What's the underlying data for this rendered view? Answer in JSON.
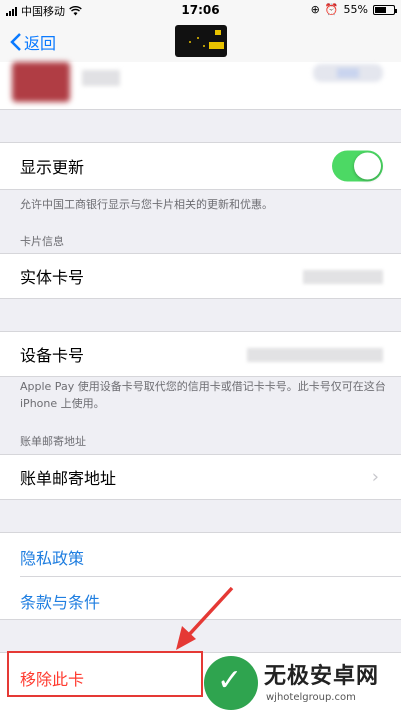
{
  "status_bar": {
    "carrier": "中国移动",
    "time": "17:06",
    "battery": "55%"
  },
  "nav": {
    "back_label": "返回"
  },
  "show_updates": {
    "label": "显示更新",
    "toggle_on": true,
    "footer": "允许中国工商银行显示与您卡片相关的更新和优惠。"
  },
  "card_info": {
    "header": "卡片信息",
    "physical_card_label": "实体卡号",
    "device_card_label": "设备卡号",
    "footer": "Apple Pay 使用设备卡号取代您的信用卡或借记卡卡号。此卡号仅可在这台 iPhone 上使用。"
  },
  "billing": {
    "header": "账单邮寄地址",
    "row_label": "账单邮寄地址"
  },
  "links": {
    "privacy": "隐私政策",
    "terms": "条款与条件"
  },
  "remove_card": "移除此卡",
  "watermark": {
    "title": "无极安卓网",
    "url": "wjhotelgroup.com"
  },
  "colors": {
    "accent": "#1f7ee0",
    "toggle": "#4cd964",
    "destructive": "#ff3b30",
    "annotation": "#e53935"
  }
}
